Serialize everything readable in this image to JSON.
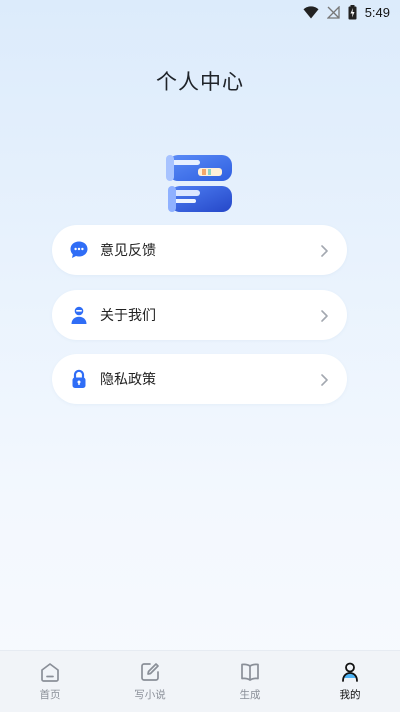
{
  "status_bar": {
    "time": "5:49"
  },
  "header": {
    "title": "个人中心"
  },
  "menu": {
    "items": [
      {
        "label": "意见反馈",
        "icon": "chat-bubble-icon"
      },
      {
        "label": "关于我们",
        "icon": "person-icon"
      },
      {
        "label": "隐私政策",
        "icon": "lock-icon"
      }
    ]
  },
  "bottom_nav": {
    "items": [
      {
        "label": "首页",
        "icon": "home-icon",
        "active": false
      },
      {
        "label": "写小说",
        "icon": "edit-icon",
        "active": false
      },
      {
        "label": "生成",
        "icon": "book-icon",
        "active": false
      },
      {
        "label": "我的",
        "icon": "user-icon",
        "active": true
      }
    ]
  },
  "colors": {
    "accent": "#2f6df6",
    "active_nav": "#111111",
    "inactive_nav": "#8a8f98",
    "card": "#ffffff"
  }
}
